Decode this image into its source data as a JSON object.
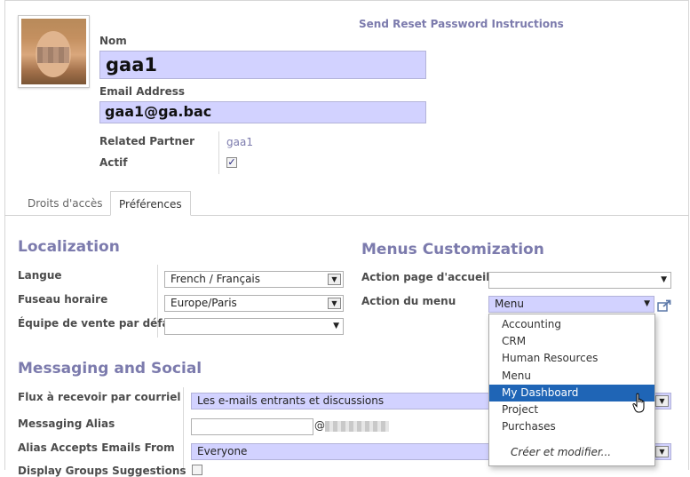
{
  "header": {
    "reset_link": "Send Reset Password Instructions",
    "name_label": "Nom",
    "name_value": "gaa1",
    "email_label": "Email Address",
    "email_value": "gaa1@ga.bac",
    "related_partner_label": "Related Partner",
    "related_partner_value": "gaa1",
    "actif_label": "Actif",
    "actif_checked": "✓"
  },
  "tabs": [
    {
      "label": "Droits d'accès"
    },
    {
      "label": "Préférences"
    }
  ],
  "localization": {
    "title": "Localization",
    "langue_label": "Langue",
    "langue_value": "French / Français",
    "fuseau_label": "Fuseau horaire",
    "fuseau_value": "Europe/Paris",
    "equipe_label": "Équipe de vente par défaut",
    "equipe_value": ""
  },
  "menus": {
    "title": "Menus Customization",
    "accueil_label": "Action page d'accueil",
    "accueil_value": "",
    "menu_label": "Action du menu",
    "menu_value": "Menu",
    "dropdown_options": [
      "Accounting",
      "CRM",
      "Human Resources",
      "Menu",
      "My Dashboard",
      "Project",
      "Purchases"
    ],
    "highlighted_option": "My Dashboard",
    "create_edit": "Créer et modifier..."
  },
  "messaging": {
    "title": "Messaging and Social",
    "flux_label": "Flux à recevoir par courriel",
    "flux_value": "Les e-mails entrants et discussions",
    "alias_label": "Messaging Alias",
    "alias_value": "",
    "alias_at": "@",
    "accepts_label": "Alias Accepts Emails From",
    "accepts_value": "Everyone",
    "groups_label": "Display Groups Suggestions"
  },
  "icons": {
    "dropdown_arrow": "▼",
    "external_link": "external-link-icon",
    "cursor": "hand-pointer-icon"
  },
  "colors": {
    "accent": "#7c7bad",
    "required_field": "#d2d2ff",
    "selected_option": "#1f65b6"
  }
}
